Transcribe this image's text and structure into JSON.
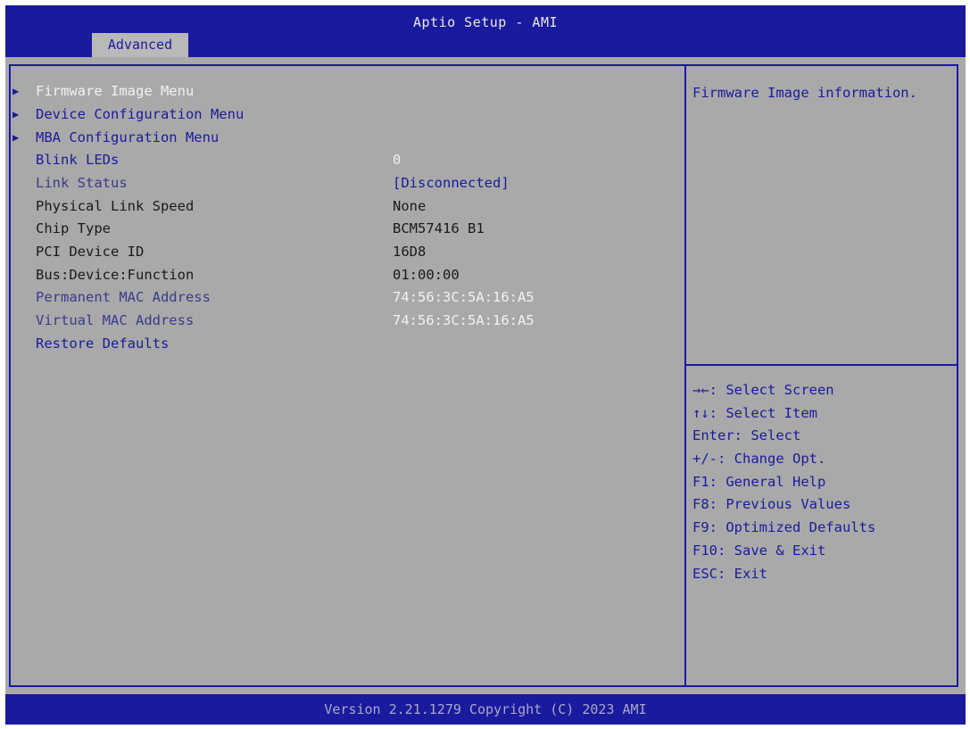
{
  "header": {
    "title": "Aptio Setup - AMI",
    "active_tab": "Advanced"
  },
  "menu": {
    "items": [
      {
        "label": "Firmware Image Menu",
        "submenu": true
      },
      {
        "label": "Device Configuration Menu",
        "submenu": true
      },
      {
        "label": "MBA Configuration Menu",
        "submenu": true
      },
      {
        "label": "Blink LEDs",
        "value": "0"
      },
      {
        "label": "Link Status",
        "value": "[Disconnected]"
      },
      {
        "label": "Physical Link Speed",
        "value": "None"
      },
      {
        "label": "Chip Type",
        "value": "BCM57416 B1"
      },
      {
        "label": "PCI Device ID",
        "value": "16D8"
      },
      {
        "label": "Bus:Device:Function",
        "value": "01:00:00"
      },
      {
        "label": "Permanent MAC Address",
        "value": "74:56:3C:5A:16:A5"
      },
      {
        "label": "Virtual MAC Address",
        "value": "74:56:3C:5A:16:A5"
      },
      {
        "label": "Restore Defaults"
      }
    ],
    "arrow_glyph": "▶"
  },
  "help": {
    "text": "Firmware Image information."
  },
  "keys": [
    "→←: Select Screen",
    "↑↓: Select Item",
    "Enter: Select",
    "+/-: Change Opt.",
    "F1: General Help",
    "F8: Previous Values",
    "F9: Optimized Defaults",
    "F10: Save & Exit",
    "ESC: Exit"
  ],
  "footer": {
    "text": "Version 2.21.1279 Copyright (C) 2023 AMI"
  },
  "colors": {
    "bios_blue": "#1a1a9e",
    "panel_gray": "#a9a9a9",
    "selected_text": "#f2f2f2"
  }
}
